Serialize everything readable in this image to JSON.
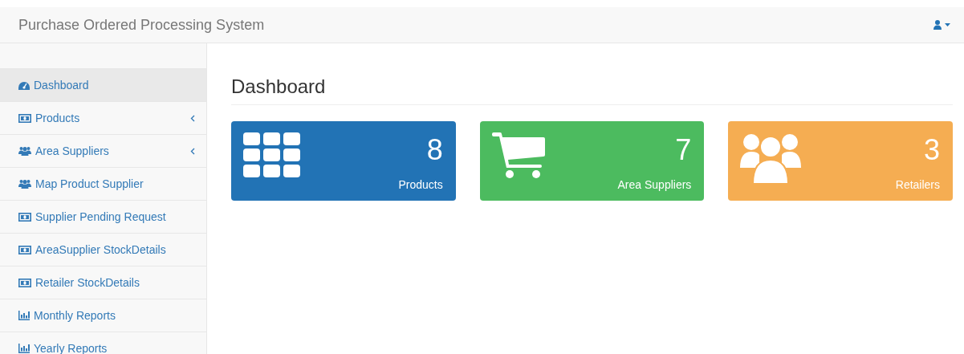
{
  "navbar": {
    "brand": "Purchase Ordered Processing System"
  },
  "sidebar": {
    "items": [
      {
        "label": "Dashboard",
        "kind": "gauge",
        "selected": true,
        "expandable": false
      },
      {
        "label": "Products",
        "kind": "money",
        "selected": false,
        "expandable": true
      },
      {
        "label": "Area Suppliers",
        "kind": "users",
        "selected": false,
        "expandable": true
      },
      {
        "label": "Map Product Supplier",
        "kind": "users",
        "selected": false,
        "expandable": false
      },
      {
        "label": "Supplier Pending Request",
        "kind": "money",
        "selected": false,
        "expandable": false
      },
      {
        "label": "AreaSupplier StockDetails",
        "kind": "money",
        "selected": false,
        "expandable": false
      },
      {
        "label": "Retailer StockDetails",
        "kind": "money",
        "selected": false,
        "expandable": false
      },
      {
        "label": "Monthly Reports",
        "kind": "chart",
        "selected": false,
        "expandable": false
      },
      {
        "label": "Yearly Reports",
        "kind": "chart",
        "selected": false,
        "expandable": false
      }
    ]
  },
  "page": {
    "title": "Dashboard"
  },
  "cards": [
    {
      "kind": "grid",
      "count": "8",
      "label": "Products",
      "color": "#2273b5"
    },
    {
      "kind": "cart",
      "count": "7",
      "label": "Area Suppliers",
      "color": "#4cbb5f"
    },
    {
      "kind": "users",
      "count": "3",
      "label": "Retailers",
      "color": "#f5ad52"
    }
  ]
}
